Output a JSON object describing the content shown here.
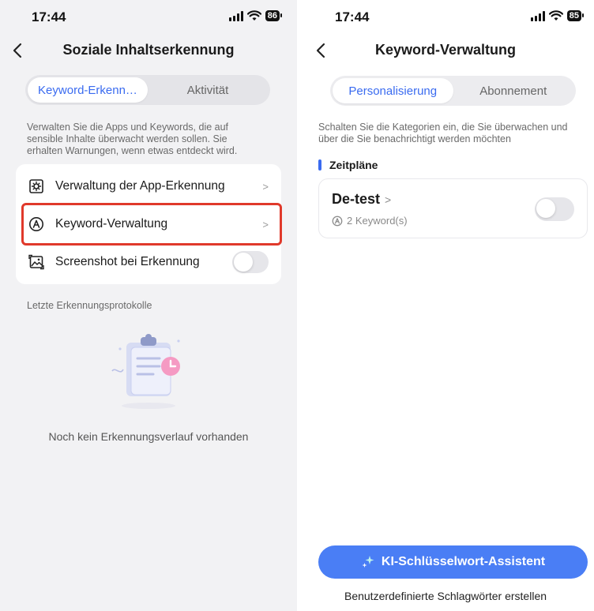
{
  "left": {
    "status": {
      "time": "17:44",
      "battery": "86"
    },
    "nav": {
      "title": "Soziale Inhaltserkennung"
    },
    "tabs": [
      {
        "label": "Keyword-Erkenn…",
        "active": true
      },
      {
        "label": "Aktivität",
        "active": false
      }
    ],
    "description": "Verwalten Sie die Apps und Keywords, die auf sensible Inhalte überwacht werden sollen. Sie erhalten Warnungen, wenn etwas entdeckt wird.",
    "settings": [
      {
        "label": "Verwaltung der App-Erkennung",
        "icon": "gear-icon"
      },
      {
        "label": "Keyword-Verwaltung",
        "icon": "keyword-a-icon"
      },
      {
        "label": "Screenshot bei Erkennung",
        "icon": "screenshot-icon",
        "toggle": false
      }
    ],
    "logs_label": "Letzte Erkennungsprotokolle",
    "empty_text": "Noch kein Erkennungsverlauf vorhanden"
  },
  "right": {
    "status": {
      "time": "17:44",
      "battery": "85"
    },
    "nav": {
      "title": "Keyword-Verwaltung"
    },
    "tabs": [
      {
        "label": "Personalisierung",
        "active": true
      },
      {
        "label": "Abonnement",
        "active": false
      }
    ],
    "description": "Schalten Sie die Kategorien ein, die Sie überwachen und über die Sie benachrichtigt werden möchten",
    "schedules_label": "Zeitpläne",
    "schedule": {
      "name": "De-test",
      "count": "2 Keyword(s)",
      "enabled": false
    },
    "assistant_button": "KI-Schlüsselwort-Assistent",
    "custom_link": "Benutzerdefinierte Schlagwörter erstellen"
  },
  "colors": {
    "accent": "#3a6bf0",
    "highlight": "#e0392b",
    "button": "#4a7ef5"
  }
}
